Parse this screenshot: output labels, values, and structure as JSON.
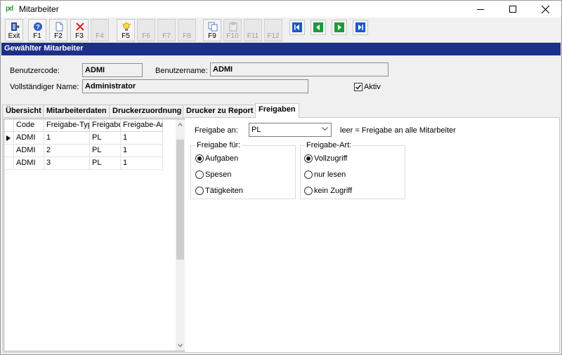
{
  "window": {
    "title": "Mitarbeiter"
  },
  "toolbar": {
    "buttons": [
      {
        "label": "Exit",
        "icon": "exit-icon",
        "enabled": true
      },
      {
        "label": "F1",
        "icon": "help-icon",
        "enabled": true
      },
      {
        "label": "F2",
        "icon": "new-document-icon",
        "enabled": true
      },
      {
        "label": "F3",
        "icon": "delete-icon",
        "enabled": true
      },
      {
        "label": "F4",
        "icon": "",
        "enabled": false
      },
      {
        "label": "F5",
        "icon": "lightbulb-icon",
        "enabled": true
      },
      {
        "label": "F6",
        "icon": "",
        "enabled": false
      },
      {
        "label": "F7",
        "icon": "",
        "enabled": false
      },
      {
        "label": "F8",
        "icon": "",
        "enabled": false
      },
      {
        "label": "F9",
        "icon": "copy-icon",
        "enabled": true
      },
      {
        "label": "F10",
        "icon": "paste-icon",
        "enabled": false
      },
      {
        "label": "F11",
        "icon": "",
        "enabled": false
      },
      {
        "label": "F12",
        "icon": "",
        "enabled": false
      }
    ],
    "nav": [
      "first-record-icon",
      "previous-record-icon",
      "next-record-icon",
      "last-record-icon"
    ]
  },
  "section": {
    "title": "Gewählter Mitarbeiter"
  },
  "employee": {
    "code_label": "Benutzercode:",
    "code_value": "ADMI",
    "name_label": "Benutzername:",
    "name_value": "ADMI",
    "fullname_label": "Vollständiger Name:",
    "fullname_value": "Administrator",
    "active_label": "Aktiv",
    "active_checked": true
  },
  "tabs": [
    {
      "label": "Übersicht",
      "active": false
    },
    {
      "label": "Mitarbeiterdaten",
      "active": false
    },
    {
      "label": "Druckerzuordnung",
      "active": false
    },
    {
      "label": "Drucker zu Report",
      "active": false
    },
    {
      "label": "Freigaben",
      "active": true
    }
  ],
  "grid": {
    "columns": [
      "Code",
      "Freigabe-Typ",
      "Freigabe",
      "Freigabe-Art"
    ],
    "rows": [
      [
        "ADMI",
        "1",
        "PL",
        "1"
      ],
      [
        "ADMI",
        "2",
        "PL",
        "1"
      ],
      [
        "ADMI",
        "3",
        "PL",
        "1"
      ]
    ]
  },
  "freigabe": {
    "an_label": "Freigabe an:",
    "an_value": "PL",
    "hint": "leer = Freigabe an alle Mitarbeiter",
    "fuer_title": "Freigabe für:",
    "fuer_options": [
      {
        "label": "Aufgaben",
        "selected": true
      },
      {
        "label": "Spesen",
        "selected": false
      },
      {
        "label": "Tätigkeiten",
        "selected": false
      }
    ],
    "art_title": "Freigabe-Art:",
    "art_options": [
      {
        "label": "Vollzugriff",
        "selected": true
      },
      {
        "label": "nur lesen",
        "selected": false
      },
      {
        "label": "kein Zugriff",
        "selected": false
      }
    ]
  }
}
